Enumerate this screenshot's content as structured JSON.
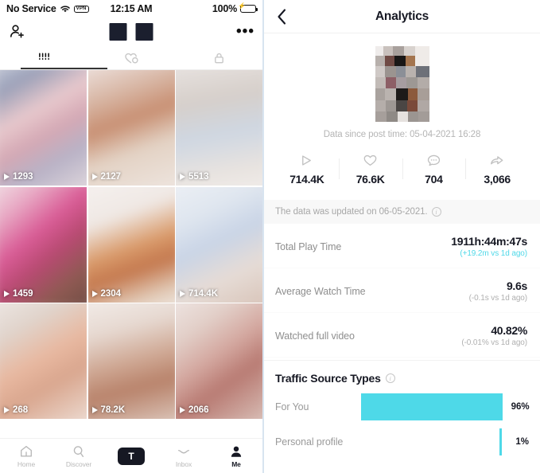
{
  "phone": {
    "status_bar": {
      "carrier": "No Service",
      "wifi_icon": "wifi-icon",
      "vpn_label": "VPN",
      "time": "12:15 AM",
      "battery_pct": "100%",
      "battery_icon": "battery-charging-icon"
    },
    "header": {
      "add_user_icon": "add-user-icon",
      "username_redacted": true,
      "more_icon": "more-horizontal-icon"
    },
    "tabs": [
      {
        "name": "tab-grid",
        "icon": "grid-posts-icon",
        "active": true
      },
      {
        "name": "tab-liked",
        "icon": "heart-lock-icon",
        "active": false
      },
      {
        "name": "tab-private",
        "icon": "lock-icon",
        "active": false
      }
    ],
    "videos": [
      {
        "views": "1293"
      },
      {
        "views": "2127"
      },
      {
        "views": "5513"
      },
      {
        "views": "1459"
      },
      {
        "views": "2304"
      },
      {
        "views": "714.4K"
      },
      {
        "views": "268"
      },
      {
        "views": "78.2K"
      },
      {
        "views": "2066"
      }
    ],
    "bottom_nav": [
      {
        "label": "Home",
        "icon": "home-icon",
        "active": false
      },
      {
        "label": "Discover",
        "icon": "search-icon",
        "active": false
      },
      {
        "label": "",
        "icon": "create-video-icon",
        "active": false,
        "is_create": true
      },
      {
        "label": "Inbox",
        "icon": "inbox-icon",
        "active": false
      },
      {
        "label": "Me",
        "icon": "profile-icon",
        "active": true
      }
    ]
  },
  "analytics": {
    "header": {
      "back_icon": "chevron-left-icon",
      "title": "Analytics"
    },
    "thumbnail_icon": "video-thumbnail-pixelated",
    "post_time_text": "Data since post time: 05-04-2021 16:28",
    "stats": [
      {
        "icon": "play-icon",
        "value": "714.4K",
        "name": "plays"
      },
      {
        "icon": "heart-icon",
        "value": "76.6K",
        "name": "likes"
      },
      {
        "icon": "comment-icon",
        "value": "704",
        "name": "comments"
      },
      {
        "icon": "share-icon",
        "value": "3,066",
        "name": "shares"
      }
    ],
    "update_banner": {
      "text": "The data was updated on 06-05-2021.",
      "info_icon": "info-icon"
    },
    "metrics": [
      {
        "label": "Total Play Time",
        "value": "1911h:44m:47s",
        "delta": "(+19.2m vs 1d ago)",
        "delta_direction": "up"
      },
      {
        "label": "Average Watch Time",
        "value": "9.6s",
        "delta": "(-0.1s vs 1d ago)",
        "delta_direction": "down"
      },
      {
        "label": "Watched full video",
        "value": "40.82%",
        "delta": "(-0.01% vs 1d ago)",
        "delta_direction": "down"
      }
    ],
    "traffic": {
      "title": "Traffic Source Types",
      "info_icon": "info-icon"
    }
  },
  "chart_data": {
    "type": "bar",
    "title": "Traffic Source Types",
    "orientation": "horizontal",
    "categories": [
      "For You",
      "Personal profile"
    ],
    "values": [
      96,
      1
    ],
    "value_labels": [
      "96%",
      "1%"
    ],
    "xlabel": "",
    "ylabel": "",
    "xlim": [
      0,
      100
    ],
    "grid": false,
    "legend": false,
    "bar_color": "#4ed9e8",
    "alignment": "right-anchored"
  },
  "colors": {
    "accent_cyan": "#4ed9e8",
    "tiktok_red": "#fe2c55",
    "tiktok_teal": "#25f4ee",
    "text_dark": "#161823",
    "text_muted": "#9a9a9a",
    "battery_green": "#3ddc6b"
  }
}
